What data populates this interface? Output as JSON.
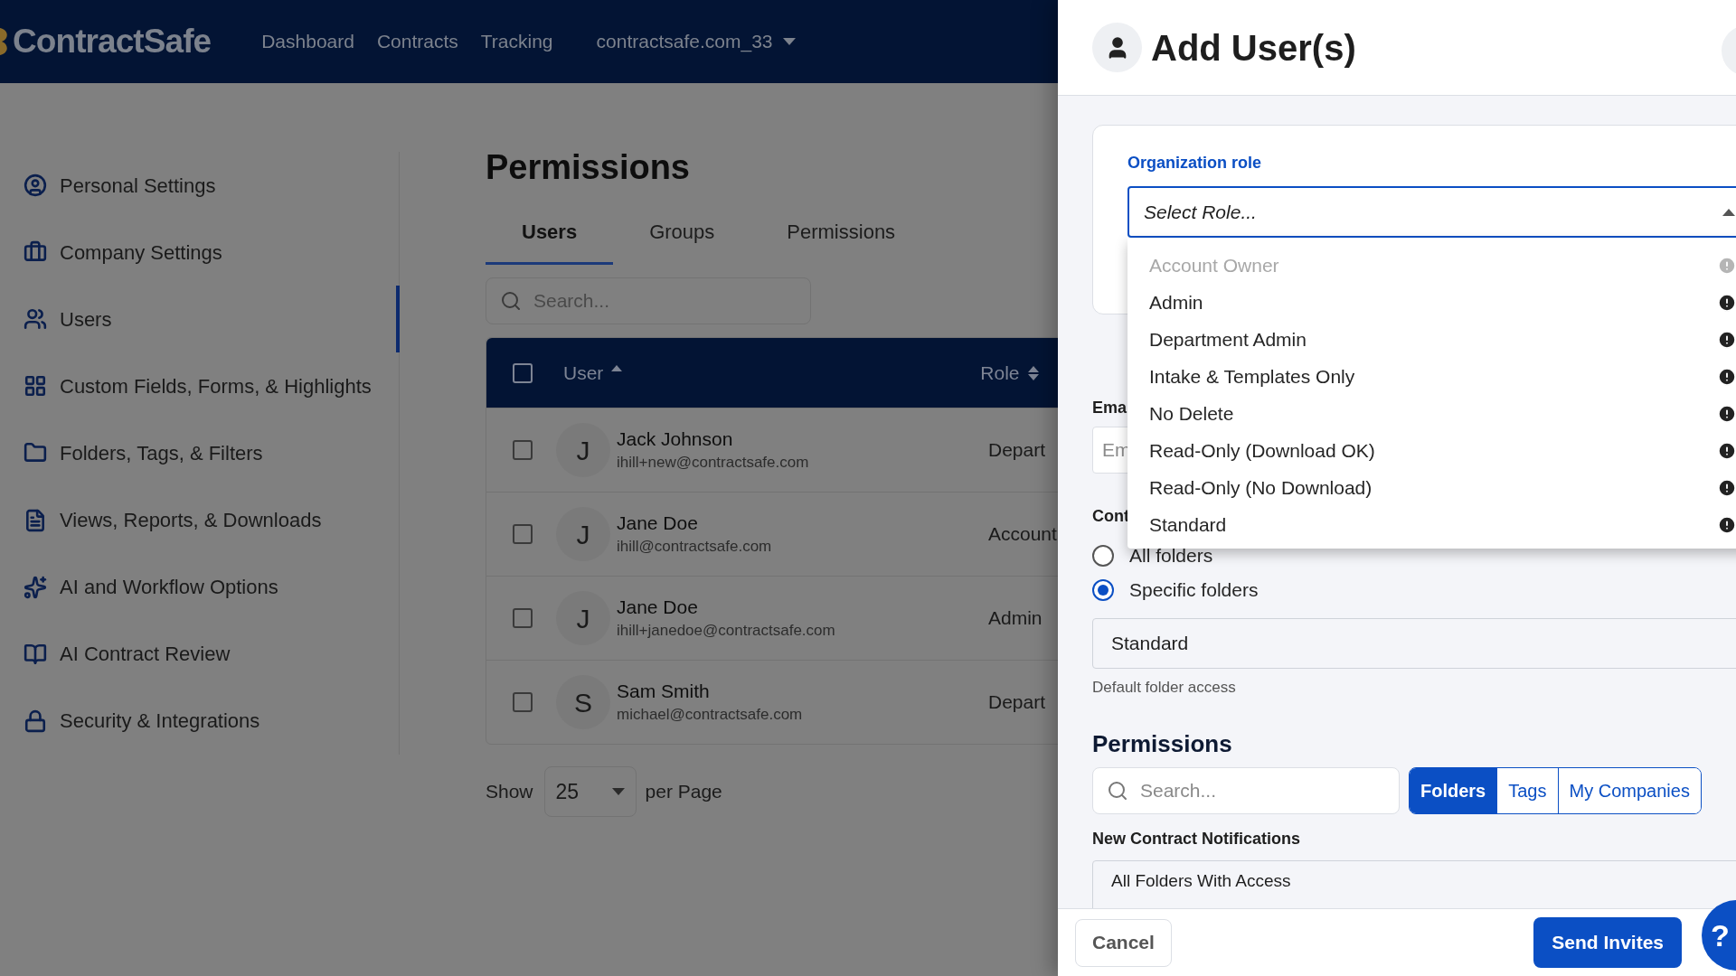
{
  "topbar": {
    "logo": "ContractSafe",
    "nav": [
      {
        "label": "Dashboard"
      },
      {
        "label": "Contracts"
      },
      {
        "label": "Tracking"
      }
    ],
    "account": "contractsafe.com_33"
  },
  "sidebar": {
    "items": [
      {
        "label": "Personal Settings",
        "selected": false
      },
      {
        "label": "Company Settings",
        "selected": false
      },
      {
        "label": "Users",
        "selected": true
      },
      {
        "label": "Custom Fields, Forms, & Highlights",
        "selected": false
      },
      {
        "label": "Folders, Tags, & Filters",
        "selected": false
      },
      {
        "label": "Views, Reports, & Downloads",
        "selected": false
      },
      {
        "label": "AI and Workflow Options",
        "selected": false
      },
      {
        "label": "AI Contract Review",
        "selected": false
      },
      {
        "label": "Security & Integrations",
        "selected": false
      }
    ]
  },
  "main": {
    "title": "Permissions",
    "tabs": [
      {
        "label": "Users",
        "selected": true
      },
      {
        "label": "Groups",
        "selected": false
      },
      {
        "label": "Permissions",
        "selected": false
      }
    ],
    "search": {
      "placeholder": "Search..."
    },
    "table": {
      "select_all_checked": false,
      "columns": [
        {
          "label": "User",
          "sorted": true
        },
        {
          "label": "Role",
          "sorted": false
        }
      ],
      "rows": [
        {
          "initial": "J",
          "name": "Jack Johnson",
          "email": "ihill+new@contractsafe.com",
          "role": "Depart",
          "checked": false
        },
        {
          "initial": "J",
          "name": "Jane Doe",
          "email": "ihill@contractsafe.com",
          "role": "Account",
          "checked": false
        },
        {
          "initial": "J",
          "name": "Jane Doe",
          "email": "ihill+janedoe@contractsafe.com",
          "role": "Admin",
          "checked": false
        },
        {
          "initial": "S",
          "name": "Sam Smith",
          "email": "michael@contractsafe.com",
          "role": "Depart",
          "checked": false
        }
      ]
    },
    "pagination": {
      "prefix": "Show",
      "value": "25",
      "suffix": "per Page"
    }
  },
  "panel": {
    "title": "Add User(s)",
    "role_label": "Organization role",
    "role_select": {
      "placeholder": "Select Role...",
      "expanded": true
    },
    "role_options": [
      {
        "label": "Account Owner",
        "disabled": true
      },
      {
        "label": "Admin",
        "disabled": false
      },
      {
        "label": "Department Admin",
        "disabled": false
      },
      {
        "label": "Intake & Templates Only",
        "disabled": false
      },
      {
        "label": "No Delete",
        "disabled": false
      },
      {
        "label": "Read-Only (Download OK)",
        "disabled": false
      },
      {
        "label": "Read-Only (No Download)",
        "disabled": false
      },
      {
        "label": "Standard",
        "disabled": false
      }
    ],
    "email_label": "Ema",
    "email_placeholder": "Em",
    "contract_label": "Cont",
    "access_options": [
      {
        "label": "All folders",
        "selected": false
      },
      {
        "label": "Specific folders",
        "selected": true
      }
    ],
    "folder_field": "Standard",
    "folder_hint": "Default folder access",
    "permissions_title": "Permissions",
    "permissions_search": {
      "placeholder": "Search..."
    },
    "segments": [
      {
        "label": "Folders",
        "selected": true
      },
      {
        "label": "Tags",
        "selected": false
      },
      {
        "label": "My Companies",
        "selected": false
      }
    ],
    "notifications_label": "New Contract Notifications",
    "notifications_value": "All Folders With Access",
    "cancel": "Cancel",
    "send": "Send Invites",
    "help": "?"
  }
}
